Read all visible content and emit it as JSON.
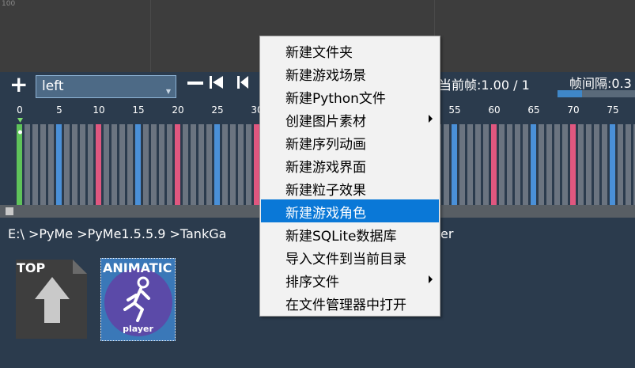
{
  "top_panel": {
    "corner_value": "100"
  },
  "toolbar": {
    "add_icon": "+",
    "dropdown_value": "left",
    "remove_icon": "—",
    "frame_info": "当前帧:1.00 / 1",
    "interval_label": "帧间隔:0.3",
    "interval_fill": 0.32
  },
  "timeline": {
    "ticks": [
      "0",
      "5",
      "10",
      "15",
      "20",
      "25",
      "30",
      "55",
      "60",
      "65",
      "70",
      "75"
    ],
    "frame_count": 80,
    "current_frame": 0
  },
  "path": {
    "text": "E:\\ >PyMe >PyMe1.5.5.9 >TankGa"
  },
  "path_tail": {
    "text": "er"
  },
  "files": {
    "top": {
      "label": "TOP"
    },
    "animation": {
      "label": "ANIMATIC",
      "name": "player"
    }
  },
  "context_menu": {
    "items": [
      {
        "label": "新建文件夹",
        "submenu": false
      },
      {
        "label": "新建游戏场景",
        "submenu": false
      },
      {
        "label": "新建Python文件",
        "submenu": false
      },
      {
        "label": "创建图片素材",
        "submenu": true
      },
      {
        "label": "新建序列动画",
        "submenu": false
      },
      {
        "label": "新建游戏界面",
        "submenu": false
      },
      {
        "label": "新建粒子效果",
        "submenu": false
      },
      {
        "label": "新建游戏角色",
        "submenu": false,
        "selected": true
      },
      {
        "label": "新建SQLite数据库",
        "submenu": false
      },
      {
        "label": "导入文件到当前目录",
        "submenu": false
      },
      {
        "label": "排序文件",
        "submenu": true
      },
      {
        "label": "在文件管理器中打开",
        "submenu": false
      }
    ]
  },
  "colors": {
    "frame_gray": "#6b7480",
    "frame_blue": "#4a90d8",
    "frame_pink": "#e0577f",
    "frame_green": "#5fc35a",
    "accent": "#0a78d7"
  }
}
